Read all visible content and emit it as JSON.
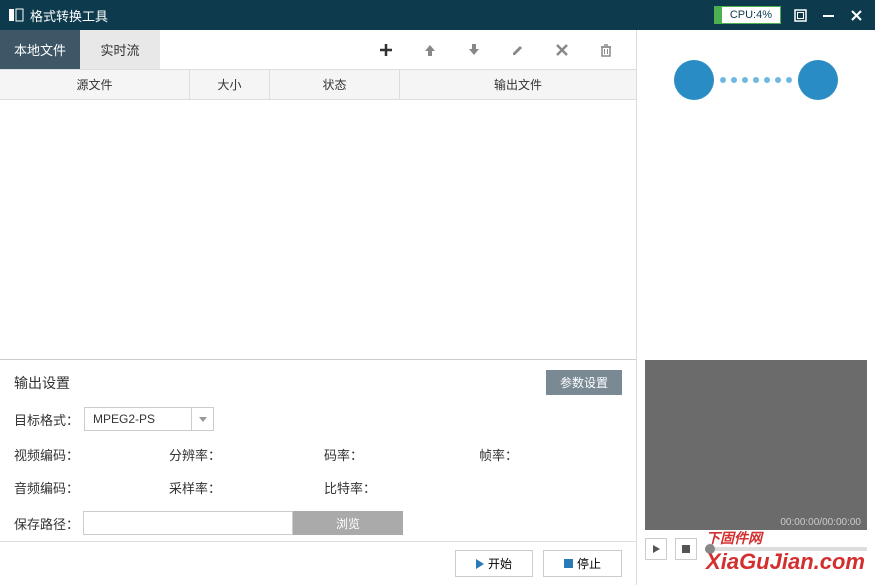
{
  "titlebar": {
    "title": "格式转换工具",
    "cpu": "CPU:4%"
  },
  "tabs": {
    "local": "本地文件",
    "stream": "实时流"
  },
  "columns": {
    "source": "源文件",
    "size": "大小",
    "status": "状态",
    "output": "输出文件"
  },
  "output": {
    "title": "输出设置",
    "param_btn": "参数设置",
    "target_format_label": "目标格式：",
    "target_format_value": "MPEG2-PS",
    "video_codec": "视频编码：",
    "resolution": "分辨率：",
    "bitrate": "码率：",
    "framerate": "帧率：",
    "audio_codec": "音频编码：",
    "samplerate": "采样率：",
    "audio_bitrate": "比特率：",
    "save_path_label": "保存路径：",
    "browse": "浏览"
  },
  "actions": {
    "start": "开始",
    "stop": "停止"
  },
  "preview": {
    "time": "00:00:00/00:00:00"
  },
  "watermark": {
    "cn": "下固件网",
    "en1": "XiaGuJian",
    "en2": ".com"
  }
}
